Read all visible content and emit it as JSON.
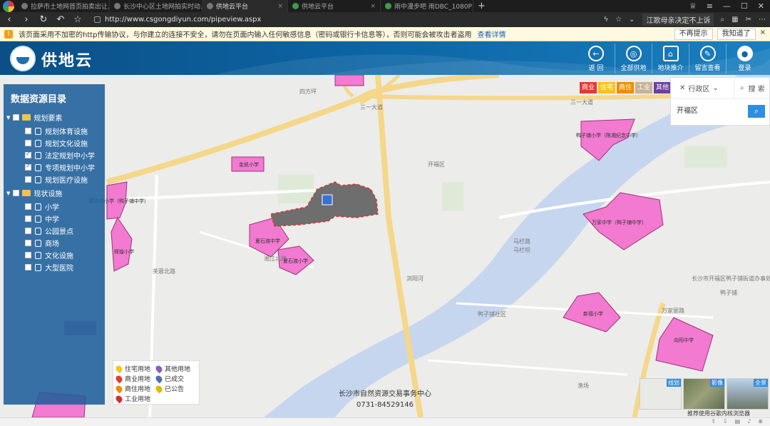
{
  "browser": {
    "tabs": [
      {
        "label": "拉萨市土地网首页拍卖出让..."
      },
      {
        "label": "长沙中心区土地网拍实时动..."
      },
      {
        "label": "供地云平台"
      },
      {
        "label": "供地云平台"
      },
      {
        "label": "雨中漫步吧 雨DBC_1080P"
      }
    ],
    "url": "http://www.csgongdiyun.com/pipeview.aspx",
    "search_hint": "江歌母亲决定不上诉"
  },
  "warning": {
    "text": "该页面采用不加密的http传输协议，与你建立的连接不安全，请勿在页面内输入任何敏感信息（密码或银行卡信息等），否则可能会被攻击者盗用",
    "link": "查看详情",
    "btn_no_remind": "不再提示",
    "btn_ok": "我知道了"
  },
  "app": {
    "title": "供地云",
    "menu": [
      {
        "label": "返 回",
        "icon": "back-icon"
      },
      {
        "label": "全部供地",
        "icon": "map-icon"
      },
      {
        "label": "地块推介",
        "icon": "house-icon"
      },
      {
        "label": "留言查看",
        "icon": "message-icon"
      },
      {
        "label": "登录",
        "icon": "user-icon"
      }
    ]
  },
  "catalog": {
    "title": "数据资源目录",
    "group1": "规划要素",
    "group1_items": [
      "规划体育设施",
      "规划文化设施",
      "法定规划中小学",
      "专项规划中小学",
      "规划医疗设施"
    ],
    "group2": "现状设施",
    "group2_items": [
      "小学",
      "中学",
      "公园景点",
      "商场",
      "文化设施",
      "大型医院"
    ]
  },
  "filters": [
    {
      "label": "商业",
      "color": "#e53935"
    },
    {
      "label": "住宅",
      "color": "#f5c518"
    },
    {
      "label": "商住",
      "color": "#f08c00"
    },
    {
      "label": "工业",
      "color": "#c7b299"
    },
    {
      "label": "其他",
      "color": "#6a3fa0"
    }
  ],
  "search": {
    "region_label": "行政区",
    "search_label": "搜 索",
    "input_value": "开福区"
  },
  "legend": [
    {
      "label": "住宅用地",
      "color": "#f5c518"
    },
    {
      "label": "其他用地",
      "color": "#8a5cc4"
    },
    {
      "label": "商业用地",
      "color": "#e53935"
    },
    {
      "label": "已成交",
      "color": "#4a6fb5"
    },
    {
      "label": "商住用地",
      "color": "#f08c00"
    },
    {
      "label": "已公告",
      "color": "#e0b800"
    },
    {
      "label": "工业用地",
      "color": "#d32f2f"
    }
  ],
  "footer": {
    "line1": "长沙市自然资源交易事务中心",
    "line2": "0731-84529146"
  },
  "thumbs": [
    "线划",
    "影像",
    "全景"
  ],
  "browser_tip": "推荐使用谷歌内核浏览器",
  "map_labels": {
    "roads": [
      "三一大道",
      "三一大道",
      "四方坪",
      "马栏路",
      "湘江北路",
      "芙蓉北路",
      "万家丽路"
    ],
    "polygons": [
      "金凯小学",
      "夏石渡中学",
      "夏石渡小学",
      "鸭子铺小学（陈湘纪念中学）",
      "万家中学（鸭子铺中学）",
      "新福小学",
      "向阳中学",
      "辉煌小学",
      "四方坪小学（鸭子铺中学）"
    ],
    "places": [
      "开福区",
      "鸭子铺社区",
      "马栏坝",
      "浏阳河",
      "渔场",
      "长沙市开福区鸭子铺街道办事处",
      "鸭子铺"
    ]
  }
}
